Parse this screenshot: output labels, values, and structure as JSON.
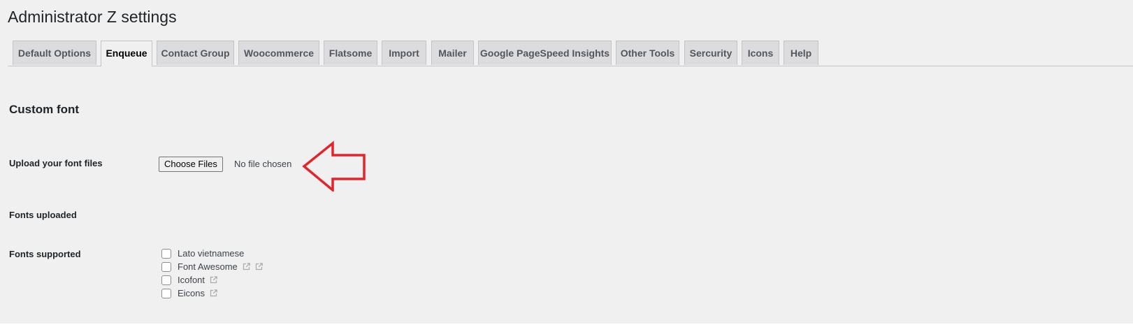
{
  "page": {
    "title": "Administrator Z settings"
  },
  "tabs": [
    {
      "label": "Default Options",
      "active": false
    },
    {
      "label": "Enqueue",
      "active": true
    },
    {
      "label": "Contact Group",
      "active": false
    },
    {
      "label": "Woocommerce",
      "active": false
    },
    {
      "label": "Flatsome",
      "active": false
    },
    {
      "label": "Import",
      "active": false
    },
    {
      "label": "Mailer",
      "active": false
    },
    {
      "label": "Google PageSpeed Insights",
      "active": false
    },
    {
      "label": "Other Tools",
      "active": false
    },
    {
      "label": "Sercurity",
      "active": false
    },
    {
      "label": "Icons",
      "active": false
    },
    {
      "label": "Help",
      "active": false
    }
  ],
  "section": {
    "title": "Custom font"
  },
  "upload": {
    "label": "Upload your font files",
    "button_label": "Choose Files",
    "status": "No file chosen"
  },
  "fonts_uploaded": {
    "label": "Fonts uploaded"
  },
  "fonts_supported": {
    "label": "Fonts supported",
    "items": [
      {
        "label": "Lato vietnamese",
        "checked": false,
        "link_icons": []
      },
      {
        "label": "Font Awesome",
        "checked": false,
        "link_icons": [
          "external-link-icon",
          "external-link-icon"
        ]
      },
      {
        "label": "Icofont",
        "checked": false,
        "link_icons": [
          "external-link-icon"
        ]
      },
      {
        "label": "Eicons",
        "checked": false,
        "link_icons": [
          "external-link-icon"
        ]
      }
    ]
  },
  "colors": {
    "background": "#f0f0f1",
    "tab_inactive": "#dcdcde",
    "border": "#c3c4c7",
    "annotation_arrow": "#e3242b",
    "link_icon": "#a7aaad"
  }
}
